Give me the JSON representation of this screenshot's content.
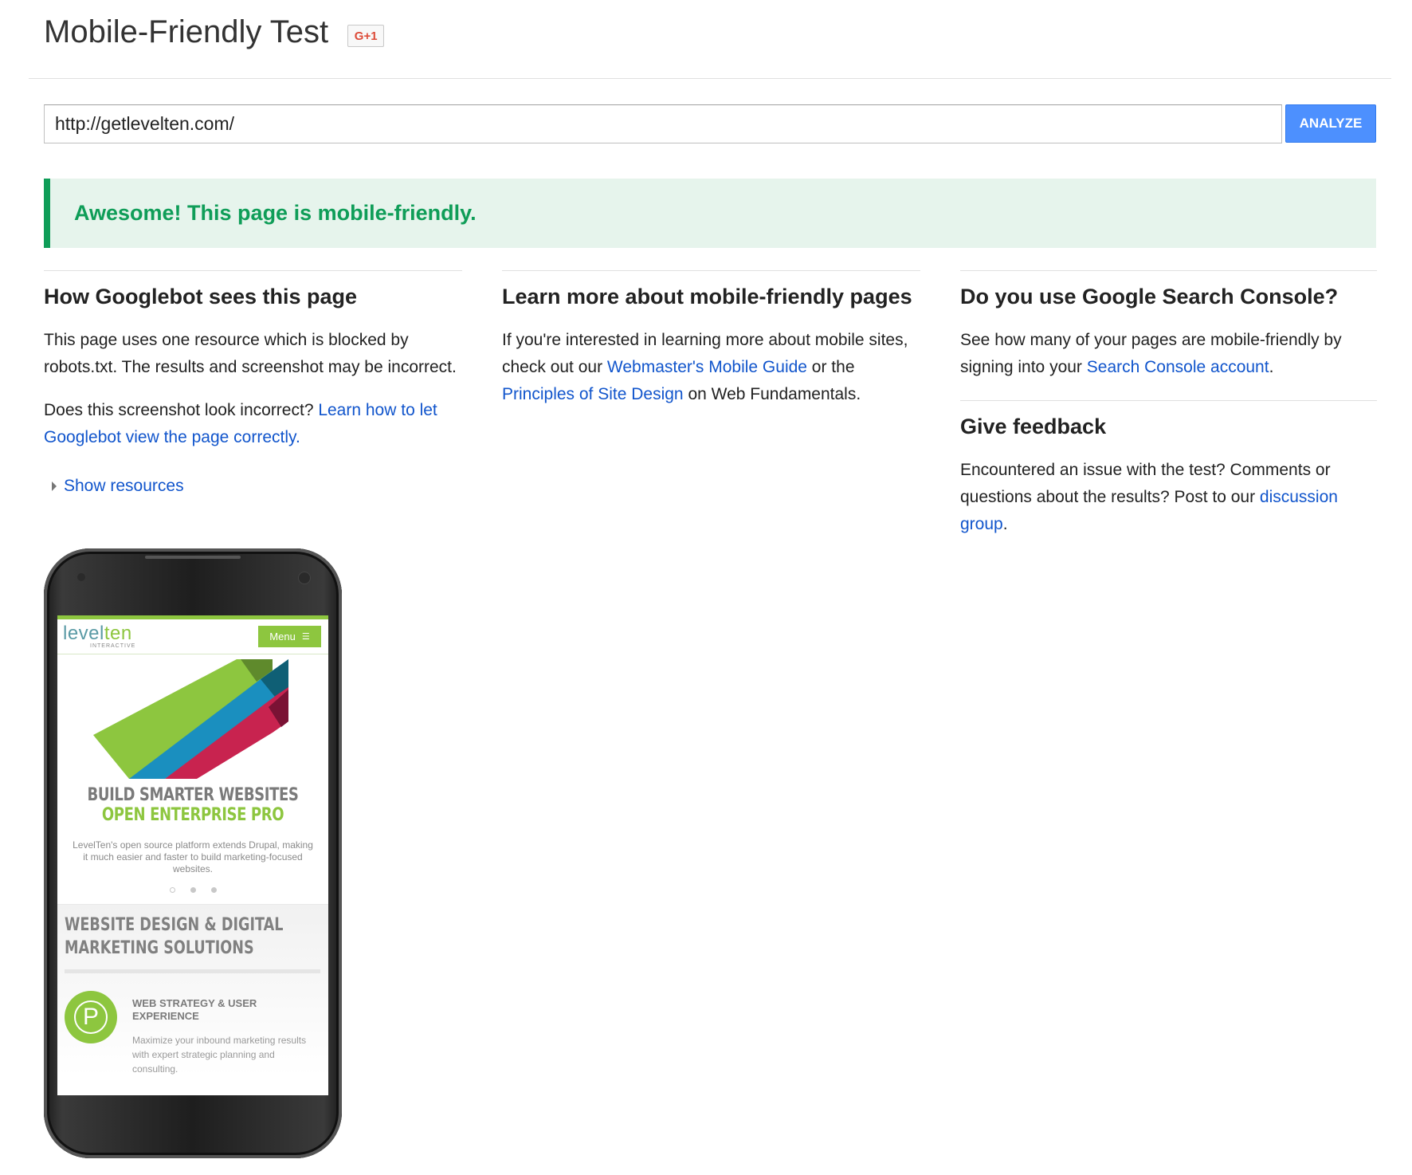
{
  "header": {
    "title": "Mobile-Friendly Test",
    "gplus_label": "G+1"
  },
  "url_form": {
    "value": "http://getlevelten.com/",
    "analyze_label": "ANALYZE"
  },
  "result": {
    "message": "Awesome! This page is mobile-friendly.",
    "status_color": "#0f9d58"
  },
  "googlebot": {
    "heading": "How Googlebot sees this page",
    "text_1": "This page uses one resource which is blocked by robots.txt. The results and screenshot may be incorrect.",
    "text_2_prefix": "Does this screenshot look incorrect? ",
    "text_2_link": "Learn how to let Googlebot view the page correctly",
    "text_2_suffix": ".",
    "show_resources": "Show resources"
  },
  "learn_more": {
    "heading": "Learn more about mobile-friendly pages",
    "text_prefix": "If you're interested in learning more about mobile sites, check out our ",
    "link_1": "Webmaster's Mobile Guide",
    "text_middle": " or the ",
    "link_2": "Principles of Site Design",
    "text_suffix": " on Web Fundamentals."
  },
  "search_console": {
    "heading": "Do you use Google Search Console?",
    "text_prefix": "See how many of your pages are mobile-friendly by signing into your ",
    "link": "Search Console account",
    "text_suffix": "."
  },
  "feedback": {
    "heading": "Give feedback",
    "text_prefix": "Encountered an issue with the test? Comments or questions about the results? Post to our ",
    "link": "discussion group",
    "text_suffix": "."
  },
  "phone_preview": {
    "logo_level": "level",
    "logo_ten": "ten",
    "logo_sub": "INTERACTIVE",
    "menu_label": "Menu",
    "hero_title_1": "BUILD SMARTER WEBSITES",
    "hero_title_2": "OPEN ENTERPRISE PRO",
    "hero_desc": "LevelTen's open source platform extends Drupal, making it much easier and faster to build marketing-focused websites.",
    "services_title_1": "WEBSITE DESIGN & DIGITAL",
    "services_title_2": "MARKETING SOLUTIONS",
    "service_badge": "P",
    "service_title": "WEB STRATEGY & USER EXPERIENCE",
    "service_desc": "Maximize your inbound marketing results with expert strategic planning and consulting."
  },
  "colors": {
    "accent_blue": "#4d90fe",
    "link_blue": "#1155cc",
    "success_green": "#0f9d58",
    "levelten_green": "#8dc63f"
  }
}
